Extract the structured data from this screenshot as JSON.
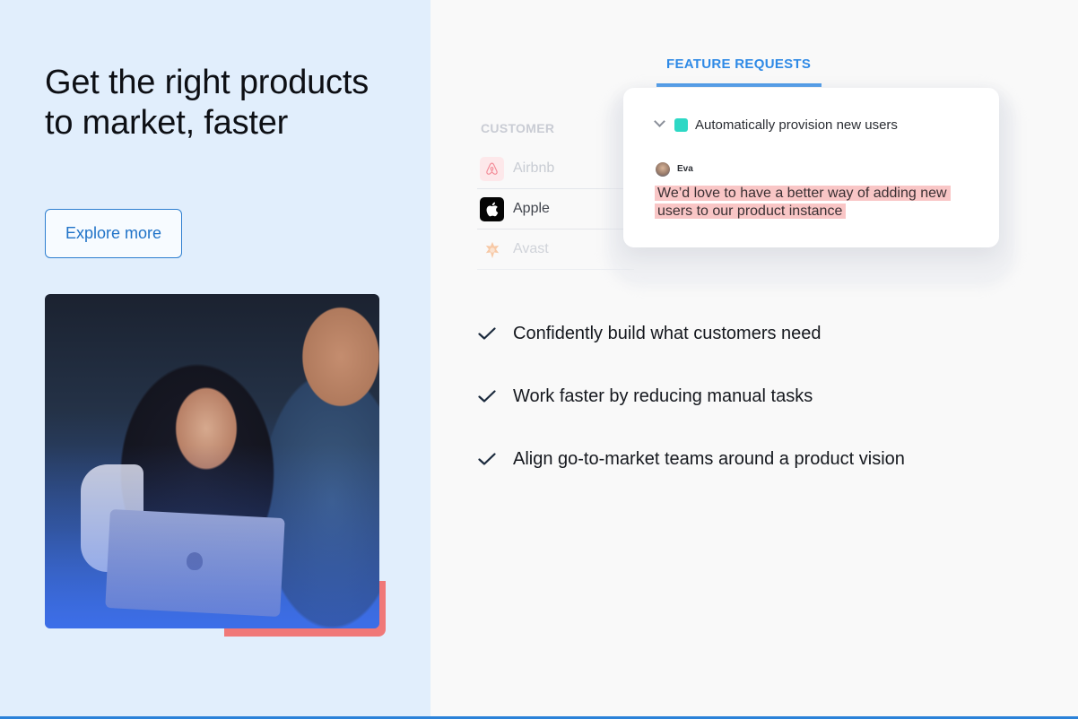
{
  "hero": {
    "headline": "Get the right products to market, faster",
    "cta_label": "Explore more",
    "photo_icon": "people-with-laptop-photo"
  },
  "feature_requests": {
    "tab_label": "FEATURE REQUESTS",
    "customer_header": "CUSTOMER",
    "customers": [
      {
        "name": "Airbnb",
        "icon": "airbnb-logo-icon",
        "muted": true
      },
      {
        "name": "Apple",
        "icon": "apple-logo-icon",
        "muted": false
      },
      {
        "name": "Avast",
        "icon": "avast-logo-icon",
        "muted": true
      }
    ],
    "card": {
      "title": "Automatically provision new users",
      "status_color": "#2dd8c5",
      "user": "Eva",
      "comment": "We’d love to have a better way of adding new users to our product instance"
    }
  },
  "benefits": [
    "Confidently build what customers need",
    "Work faster by reducing manual tasks",
    "Align go-to-market teams around a product vision"
  ],
  "colors": {
    "accent": "#2f8ae6",
    "left_bg": "#e1eefc",
    "highlight": "#f9c6c6",
    "photo_accent": "#f07878"
  }
}
